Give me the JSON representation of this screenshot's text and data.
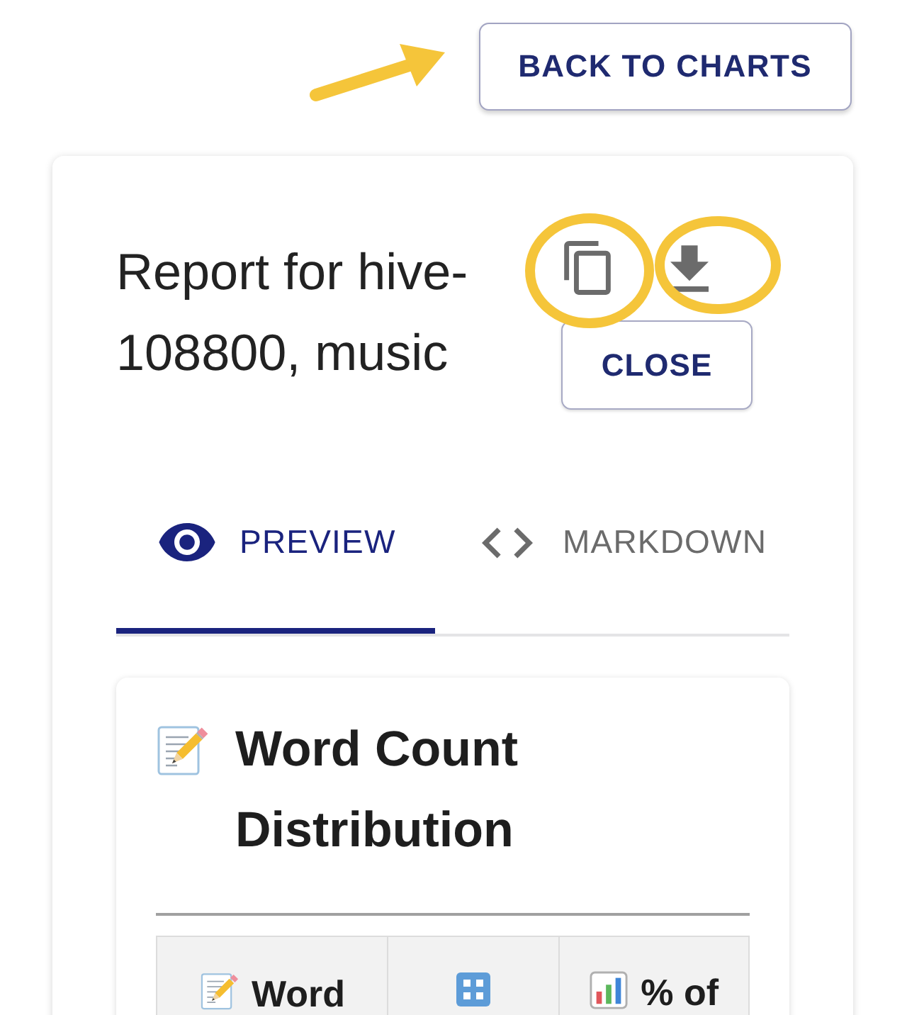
{
  "back_button": {
    "label": "BACK TO CHARTS"
  },
  "report": {
    "title": "Report for hive-108800, music",
    "close_button": {
      "label": "CLOSE"
    }
  },
  "tabs": [
    {
      "label": "PREVIEW",
      "selected": true
    },
    {
      "label": "MARKDOWN",
      "selected": false
    }
  ],
  "preview": {
    "heading": "Word Count Distribution",
    "table": {
      "columns": [
        {
          "kind": "labeled",
          "label": "Word"
        },
        {
          "kind": "icon_only"
        },
        {
          "kind": "labeled",
          "label": "% of"
        }
      ]
    }
  }
}
